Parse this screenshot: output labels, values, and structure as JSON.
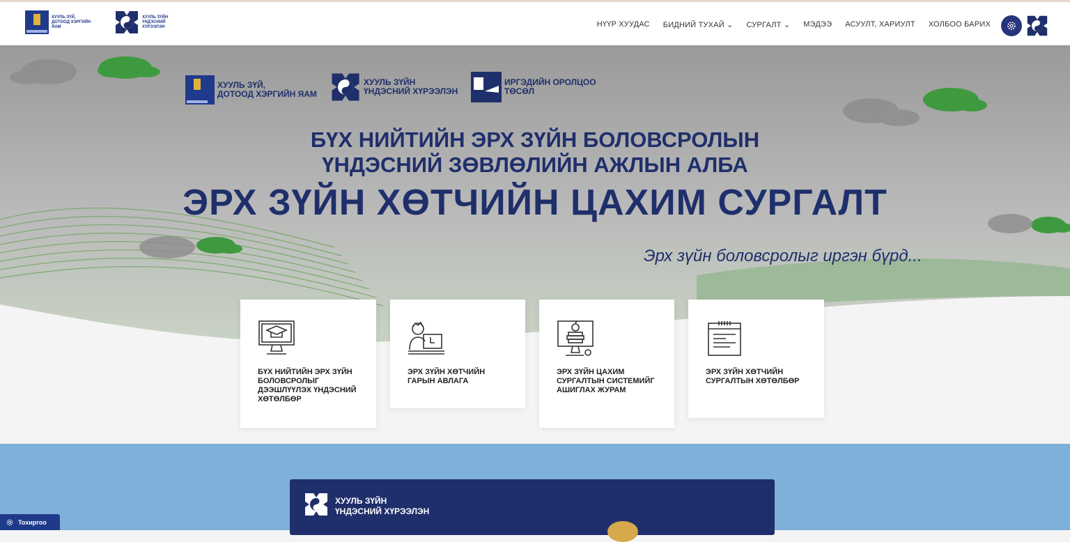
{
  "header": {
    "ministry_logo_text_line1": "ХУУЛЬ ЗҮЙ,",
    "ministry_logo_text_line2": "ДОТООД ХЭРГИЙН ЯАМ",
    "institute_logo_text_line1": "ХУУЛЬ ЗҮЙН",
    "institute_logo_text_line2": "ҮНДЭСНИЙ ХҮРЭЭЛЭН",
    "nav": [
      {
        "label": "НҮҮР ХУУДАС"
      },
      {
        "label": "БИДНИЙ ТУХАЙ ⌄"
      },
      {
        "label": "СУРГАЛТ ⌄"
      },
      {
        "label": "МЭДЭЭ"
      },
      {
        "label": "АСУУЛТ, ХАРИУЛТ"
      },
      {
        "label": "ХОЛБОО БАРИХ"
      }
    ]
  },
  "hero": {
    "partners": [
      {
        "line1": "ХУУЛЬ ЗҮЙ,",
        "line2": "ДОТООД ХЭРГИЙН ЯАМ"
      },
      {
        "line1": "ХУУЛЬ ЗҮЙН",
        "line2": "ҮНДЭСНИЙ ХҮРЭЭЛЭН"
      },
      {
        "line1": "ИРГЭДИЙН ОРОЛЦОО",
        "line2": "ТӨСӨЛ"
      }
    ],
    "title_line1": "БҮХ НИЙТИЙН ЭРХ ЗҮЙН БОЛОВСРОЛЫН",
    "title_line2": "ҮНДЭСНИЙ ЗӨВЛӨЛИЙН АЖЛЫН АЛБА",
    "title_main": "ЭРХ ЗҮЙН ХӨТЧИЙН ЦАХИМ СУРГАЛТ",
    "slogan": "Эрх зүйн боловсролыг иргэн бүрд...",
    "cards": [
      {
        "label": "БҮХ НИЙТИЙН ЭРХ ЗҮЙН БОЛОВСРОЛЫГ ДЭЭШЛҮҮЛЭХ ҮНДЭСНИЙ ХӨТӨЛБӨР",
        "icon": "graduation-monitor-icon"
      },
      {
        "label": "ЭРХ ЗҮЙН ХӨТЧИЙН ГАРЫН АВЛАГА",
        "icon": "person-computer-icon"
      },
      {
        "label": "ЭРХ ЗҮЙН ЦАХИМ СУРГАЛТЫН СИСТЕМИЙГ АШИГЛАХ ЖУРАМ",
        "icon": "apple-books-monitor-icon"
      },
      {
        "label": "ЭРХ ЗҮЙН ХӨТЧИЙН СУРГАЛТЫН ХӨТӨЛБӨР",
        "icon": "calendar-notes-icon"
      }
    ]
  },
  "banner": {
    "line1": "ХУУЛЬ ЗҮЙН",
    "line2": "ҮНДЭСНИЙ ХҮРЭЭЛЭН"
  },
  "settings_tab": {
    "label": "Тохиргоо"
  },
  "colors": {
    "navy": "#1f2f6b",
    "blue_section": "#7eb0d9",
    "green": "#3f9a3f"
  }
}
